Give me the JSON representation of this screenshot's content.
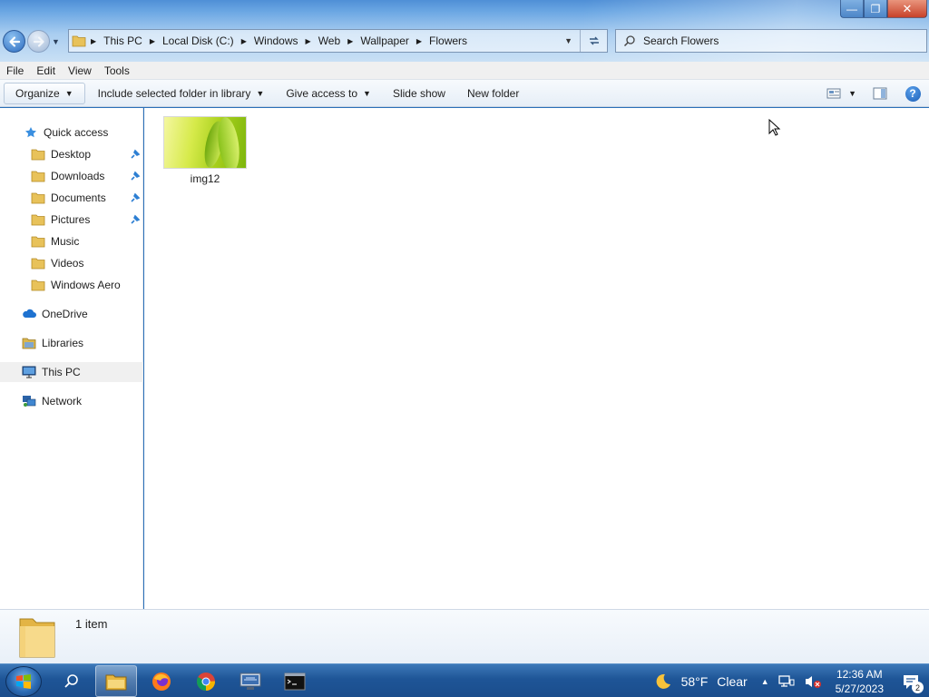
{
  "window": {
    "controls": {
      "minimize": "—",
      "maximize": "❐",
      "close": "✕"
    }
  },
  "navigation": {
    "back_icon": "arrow-left-icon",
    "forward_icon": "arrow-right-icon"
  },
  "address": {
    "breadcrumbs": [
      "This PC",
      "Local Disk (C:)",
      "Windows",
      "Web",
      "Wallpaper",
      "Flowers"
    ]
  },
  "search": {
    "placeholder": "Search Flowers"
  },
  "menubar": {
    "items": [
      "File",
      "Edit",
      "View",
      "Tools"
    ]
  },
  "commandbar": {
    "organize": "Organize",
    "include": "Include selected folder in library",
    "share": "Give access to",
    "slideshow": "Slide show",
    "newfolder": "New folder",
    "help": "?"
  },
  "sidebar": {
    "quick_access": "Quick access",
    "items": [
      {
        "label": "Desktop",
        "pinned": true
      },
      {
        "label": "Downloads",
        "pinned": true
      },
      {
        "label": "Documents",
        "pinned": true
      },
      {
        "label": "Pictures",
        "pinned": true
      },
      {
        "label": "Music",
        "pinned": false
      },
      {
        "label": "Videos",
        "pinned": false
      },
      {
        "label": "Windows Aero",
        "pinned": false
      }
    ],
    "onedrive": "OneDrive",
    "libraries": "Libraries",
    "thispc": "This PC",
    "network": "Network"
  },
  "files": [
    {
      "name": "img12",
      "type": "image"
    }
  ],
  "details": {
    "count": "1 item"
  },
  "taskbar": {
    "apps": [
      "file-explorer",
      "firefox",
      "chrome",
      "network-app",
      "command-prompt"
    ],
    "weather": {
      "temp": "58°F",
      "condition": "Clear"
    },
    "clock": {
      "time": "12:36 AM",
      "date": "5/27/2023"
    },
    "notifications": "2"
  },
  "colors": {
    "accent": "#2a6fb8",
    "taskbar": "#1e5597",
    "selection": "#f0f0f0"
  }
}
